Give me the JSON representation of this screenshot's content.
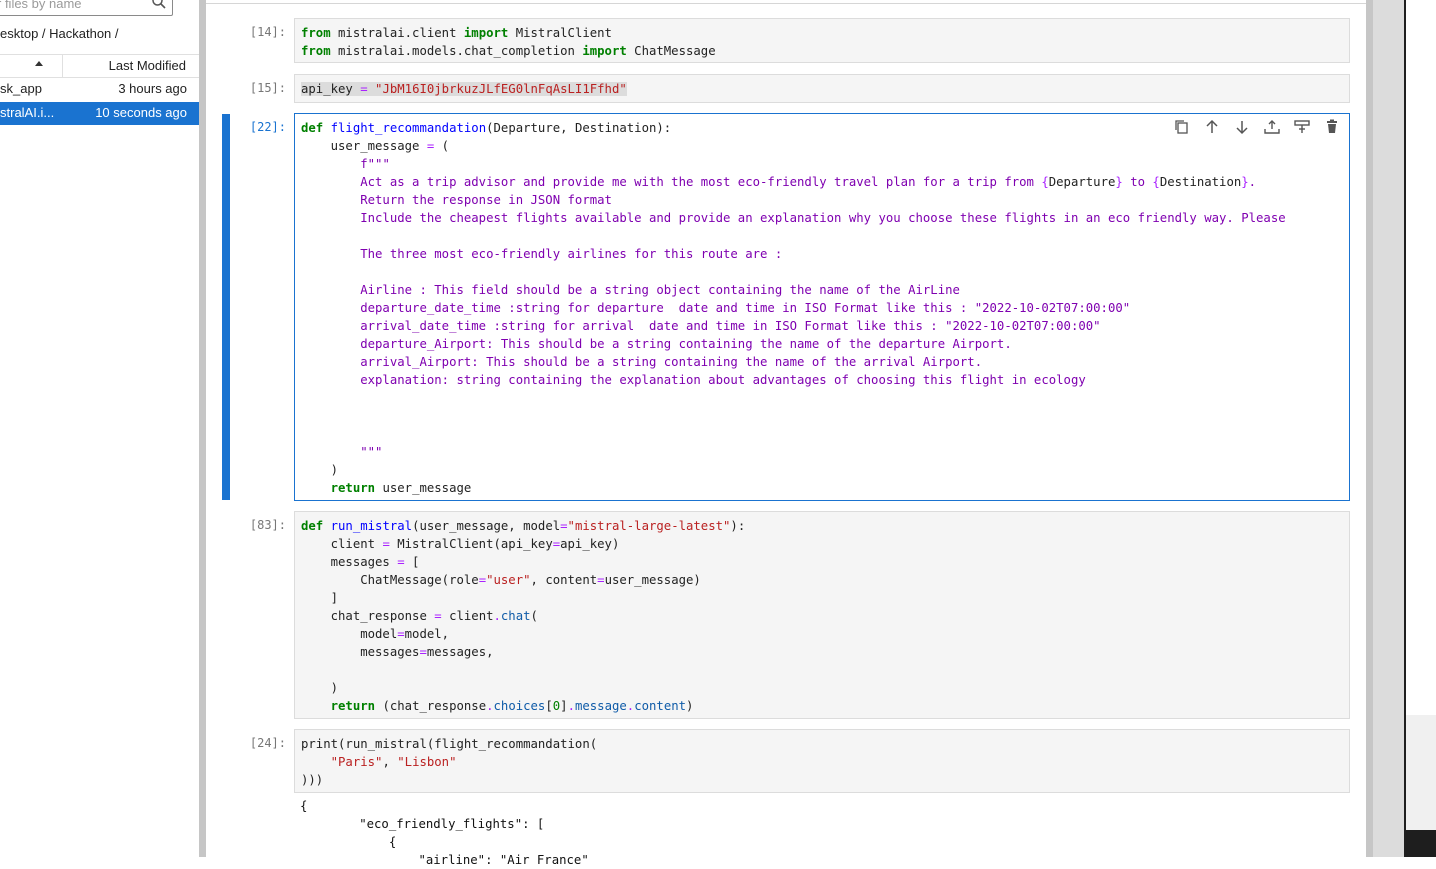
{
  "file_browser": {
    "search_placeholder": "r files by name",
    "breadcrumb": "esktop / Hackathon /",
    "column_last_modified": "Last Modified",
    "files": [
      {
        "name": "sk_app",
        "modified": "3 hours ago",
        "selected": false
      },
      {
        "name": "stralAI.i...",
        "modified": "10 seconds ago",
        "selected": true
      }
    ]
  },
  "cells": [
    {
      "prompt": "[14]:"
    },
    {
      "prompt": "[15]:"
    },
    {
      "prompt": "[22]:"
    },
    {
      "prompt": "[83]:"
    },
    {
      "prompt": "[24]:"
    }
  ],
  "icons": {
    "search": "search-icon",
    "sort": "sort-ascending-icon",
    "toolbar": [
      "duplicate-icon",
      "move-up-icon",
      "move-down-icon",
      "insert-below-icon",
      "insert-above-icon",
      "delete-icon"
    ]
  },
  "colors": {
    "accent": "#1a73d0",
    "keyword": "#008000",
    "string": "#ba2121",
    "docstring": "#7f00b0"
  }
}
